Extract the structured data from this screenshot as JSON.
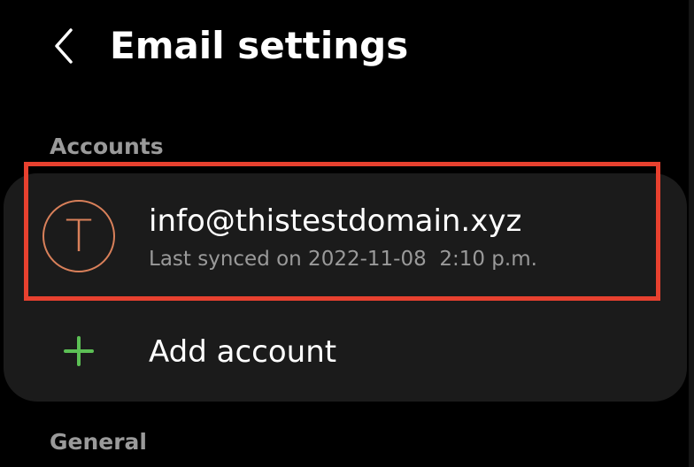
{
  "header": {
    "title": "Email settings"
  },
  "sections": {
    "accounts_label": "Accounts",
    "general_label": "General"
  },
  "account": {
    "avatar_initial": "T",
    "email": "info@thistestdomain.xyz",
    "last_synced": "Last synced on 2022-11-08  2:10 p.m."
  },
  "add_account": {
    "label": "Add account"
  },
  "icons": {
    "back": "chevron-left-icon",
    "add": "plus-icon"
  },
  "colors": {
    "background": "#000000",
    "card": "#1b1b1b",
    "avatar_accent": "#d9805a",
    "add_accent": "#5cc055",
    "highlight": "#e8412f",
    "secondary_text": "#9a9a9a"
  }
}
